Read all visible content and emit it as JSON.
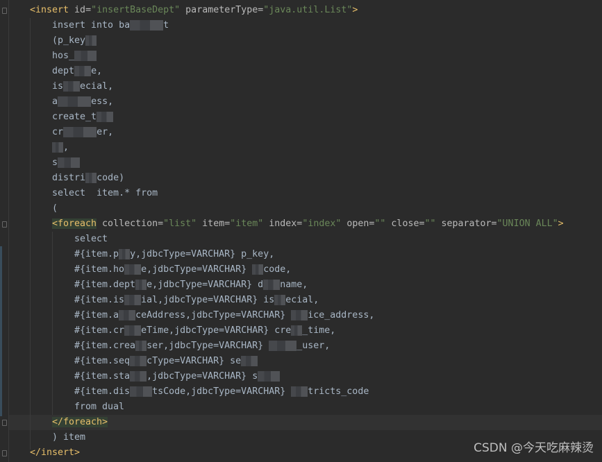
{
  "editor": {
    "lines": [
      [
        [
          "<insert",
          "tag"
        ],
        [
          " id=",
          "attr"
        ],
        [
          "\"insertBaseDept\"",
          "val"
        ],
        [
          " parameterType=",
          "attr"
        ],
        [
          "\"java.util.List\"",
          "val"
        ],
        [
          ">",
          "tag"
        ]
      ],
      [
        [
          "insert into ba",
          ""
        ],
        [
          "      ",
          "blur"
        ],
        [
          "t",
          ""
        ]
      ],
      [
        [
          "(p_key",
          ""
        ],
        [
          "  ",
          "blur"
        ]
      ],
      [
        [
          "hos_",
          ""
        ],
        [
          "    ",
          "blur"
        ]
      ],
      [
        [
          "dept",
          ""
        ],
        [
          "   ",
          "blur"
        ],
        [
          "e,",
          ""
        ]
      ],
      [
        [
          "is",
          ""
        ],
        [
          "   ",
          "blur"
        ],
        [
          "ecial,",
          ""
        ]
      ],
      [
        [
          "a",
          ""
        ],
        [
          "      ",
          "blur"
        ],
        [
          "ess,",
          ""
        ]
      ],
      [
        [
          "create_t",
          ""
        ],
        [
          "   ",
          "blur"
        ]
      ],
      [
        [
          "cr",
          ""
        ],
        [
          "      ",
          "blur"
        ],
        [
          "er,",
          ""
        ]
      ],
      [
        [
          "  ",
          "blur"
        ],
        [
          ",",
          ""
        ]
      ],
      [
        [
          "s",
          ""
        ],
        [
          "    ",
          "blur"
        ]
      ],
      [
        [
          "distri",
          ""
        ],
        [
          "  ",
          "blur"
        ],
        [
          "code)",
          ""
        ]
      ],
      [
        [
          "select  item.* from",
          ""
        ]
      ],
      [
        [
          "(",
          ""
        ]
      ],
      [
        [
          "<foreach",
          "tag hl"
        ],
        [
          " collection=",
          "attr"
        ],
        [
          "\"list\"",
          "val"
        ],
        [
          " item=",
          "attr"
        ],
        [
          "\"item\"",
          "val"
        ],
        [
          " index=",
          "attr"
        ],
        [
          "\"index\"",
          "val"
        ],
        [
          " open=",
          "attr"
        ],
        [
          "\"\"",
          "val"
        ],
        [
          " close=",
          "attr"
        ],
        [
          "\"\"",
          "val"
        ],
        [
          " separator=",
          "attr"
        ],
        [
          "\"UNION ALL\"",
          "val"
        ],
        [
          ">",
          "tag"
        ]
      ],
      [
        [
          "select",
          ""
        ]
      ],
      [
        [
          "#{item.p",
          ""
        ],
        [
          "  ",
          "blur"
        ],
        [
          "y,jdbcType=VARCHAR} p_key,",
          ""
        ]
      ],
      [
        [
          "#{item.ho",
          ""
        ],
        [
          "   ",
          "blur"
        ],
        [
          "e,jdbcType=VARCHAR} ",
          ""
        ],
        [
          "  ",
          "blur"
        ],
        [
          "code,",
          ""
        ]
      ],
      [
        [
          "#{item.dept",
          ""
        ],
        [
          "  ",
          "blur"
        ],
        [
          "e,jdbcType=VARCHAR} d",
          ""
        ],
        [
          "   ",
          "blur"
        ],
        [
          "name,",
          ""
        ]
      ],
      [
        [
          "#{item.is",
          ""
        ],
        [
          "   ",
          "blur"
        ],
        [
          "ial,jdbcType=VARCHAR} is",
          ""
        ],
        [
          "  ",
          "blur"
        ],
        [
          "ecial,",
          ""
        ]
      ],
      [
        [
          "#{item.a",
          ""
        ],
        [
          "   ",
          "blur"
        ],
        [
          "ceAddress,jdbcType=VARCHAR} ",
          ""
        ],
        [
          "   ",
          "blur"
        ],
        [
          "ice_address,",
          ""
        ]
      ],
      [
        [
          "#{item.cr",
          ""
        ],
        [
          "   ",
          "blur"
        ],
        [
          "eTime,jdbcType=VARCHAR} cre",
          ""
        ],
        [
          "  ",
          "blur"
        ],
        [
          "_time,",
          ""
        ]
      ],
      [
        [
          "#{item.crea",
          ""
        ],
        [
          "  ",
          "blur"
        ],
        [
          "ser,jdbcType=VARCHAR} ",
          ""
        ],
        [
          "     ",
          "blur"
        ],
        [
          "_user,",
          ""
        ]
      ],
      [
        [
          "#{item.seq",
          ""
        ],
        [
          "   ",
          "blur"
        ],
        [
          "cType=VARCHAR} se",
          ""
        ],
        [
          "   ",
          "blur"
        ]
      ],
      [
        [
          "#{item.sta",
          ""
        ],
        [
          "   ",
          "blur"
        ],
        [
          ",jdbcType=VARCHAR} s",
          ""
        ],
        [
          "    ",
          "blur"
        ]
      ],
      [
        [
          "#{item.dis",
          ""
        ],
        [
          "    ",
          "blur"
        ],
        [
          "tsCode,jdbcType=VARCHAR} ",
          ""
        ],
        [
          "   ",
          "blur"
        ],
        [
          "tricts_code",
          ""
        ]
      ],
      [
        [
          "from dual",
          ""
        ]
      ],
      [
        [
          "</foreach>",
          "tag hl"
        ]
      ],
      [
        [
          ") item",
          ""
        ]
      ],
      [
        [
          "</insert>",
          "tag"
        ]
      ]
    ],
    "indents": [
      0,
      1,
      1,
      1,
      1,
      1,
      1,
      1,
      1,
      1,
      1,
      1,
      1,
      1,
      1,
      2,
      2,
      2,
      2,
      2,
      2,
      2,
      2,
      2,
      2,
      2,
      2,
      1,
      1,
      0
    ]
  },
  "watermark": "CSDN @今天吃麻辣烫"
}
